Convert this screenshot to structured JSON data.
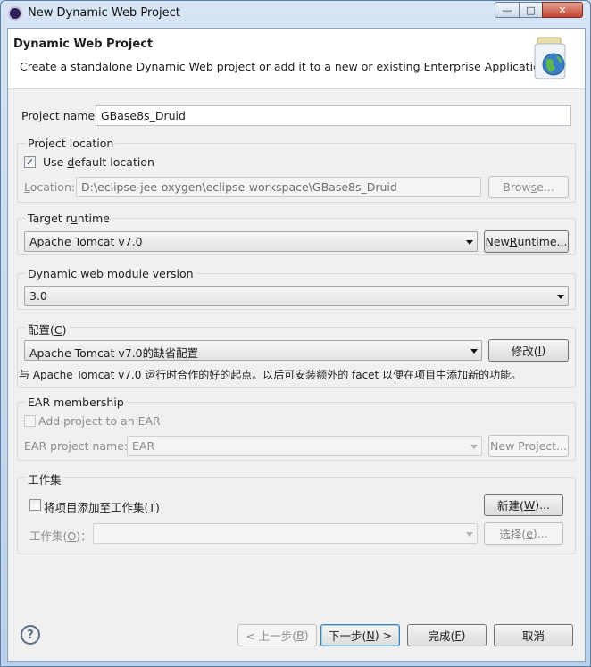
{
  "window": {
    "title": "New Dynamic Web Project",
    "minimize_icon": "minimize-icon",
    "maximize_icon": "maximize-icon",
    "close_icon": "close-icon"
  },
  "header": {
    "title": "Dynamic Web Project",
    "description": "Create a standalone Dynamic Web project or add it to a new or existing Enterprise Application."
  },
  "project_name": {
    "label_a": "Project na",
    "label_mn": "m",
    "label_b": "e:",
    "value": "GBase8s_Druid"
  },
  "project_location": {
    "group_title": "Project location",
    "use_default_a": "Use ",
    "use_default_mn": "d",
    "use_default_b": "efault location",
    "use_default_checked": true,
    "location_label_a": "L",
    "location_label_b": "ocation:",
    "location_value": "D:\\eclipse-jee-oxygen\\eclipse-workspace\\GBase8s_Druid",
    "browse_a": "Brow",
    "browse_mn": "s",
    "browse_b": "e..."
  },
  "target_runtime": {
    "group_title_a": "Target r",
    "group_title_mn": "u",
    "group_title_b": "ntime",
    "selected": "Apache Tomcat v7.0",
    "new_runtime_a": "New ",
    "new_runtime_mn": "R",
    "new_runtime_b": "untime..."
  },
  "module_version": {
    "group_title_a": "Dynamic web module ",
    "group_title_mn": "v",
    "group_title_b": "ersion",
    "selected": "3.0"
  },
  "configuration": {
    "group_title_a": "配置(",
    "group_title_mn": "C",
    "group_title_b": ")",
    "selected": "Apache Tomcat v7.0的缺省配置",
    "modify_a": "修改(",
    "modify_mn": "I",
    "modify_b": ")",
    "description": "与 Apache Tomcat v7.0 运行时合作的好的起点。以后可安装额外的 facet 以便在项目中添加新的功能。"
  },
  "ear": {
    "group_title": "EAR membership",
    "add_label": "Add project to an EAR",
    "add_checked": false,
    "name_label_a": "EAR project name:",
    "name_value": "EAR",
    "new_project": "New Project..."
  },
  "working_set": {
    "group_title": "工作集",
    "add_a": "将项目添加至工作集(",
    "add_mn": "T",
    "add_b": ")",
    "add_checked": false,
    "new_a": "新建(",
    "new_mn": "W",
    "new_b": ")...",
    "label_a": "工作集(",
    "label_mn": "O",
    "label_b": ")：",
    "select_a": "选择(",
    "select_mn": "e",
    "select_b": ")..."
  },
  "footer": {
    "help_icon": "help-icon",
    "help_glyph": "?",
    "back_a": "< 上一步(",
    "back_mn": "B",
    "back_b": ")",
    "next_a": "下一步(",
    "next_mn": "N",
    "next_b": ") >",
    "finish_a": "完成(",
    "finish_mn": "F",
    "finish_b": ")",
    "cancel": "取消"
  }
}
